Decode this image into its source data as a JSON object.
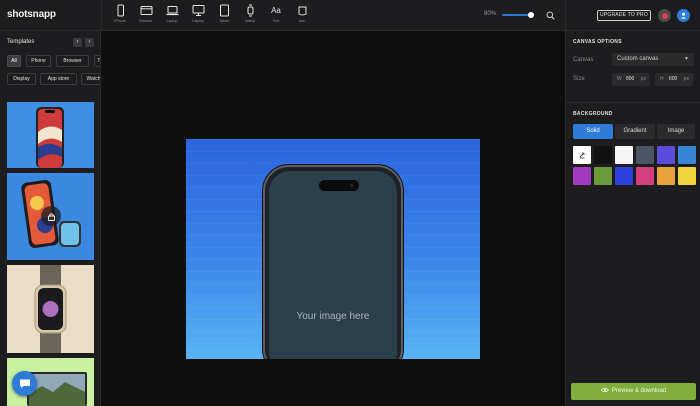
{
  "app": {
    "logo": "shotsnapp"
  },
  "devices": [
    {
      "icon": "phone-icon",
      "label": "iPhone"
    },
    {
      "icon": "browser-icon",
      "label": "Browser"
    },
    {
      "icon": "laptop-icon",
      "label": "Laptop"
    },
    {
      "icon": "display-icon",
      "label": "Display"
    },
    {
      "icon": "tablet-icon",
      "label": "Tablet"
    },
    {
      "icon": "watch-icon",
      "label": "Watch"
    },
    {
      "icon": "text-icon",
      "glyph": "Aa",
      "label": "Text"
    },
    {
      "icon": "icon-tool-icon",
      "label": "Icon"
    }
  ],
  "zoom": {
    "label": "80%",
    "value": 80
  },
  "header": {
    "upgrade_label": "UPGRADE TO PRO"
  },
  "sidebar": {
    "title": "Templates",
    "prev": "‹",
    "next": "›",
    "filters": [
      "All",
      "Phone",
      "Browser",
      "Ta",
      "Display",
      "App store",
      "Watch"
    ],
    "active_filter": "All"
  },
  "canvas": {
    "placeholder": "Your image here"
  },
  "canvas_options": {
    "title": "CANVAS OPTIONS",
    "canvas_label": "Canvas",
    "canvas_value": "Custom canvas",
    "size_label": "Size",
    "width_key": "W",
    "width_value": "800",
    "height_key": "H",
    "height_value": "600",
    "unit": "px"
  },
  "background": {
    "title": "BACKGROUND",
    "tabs": [
      "Solid",
      "Gradient",
      "Image"
    ],
    "active_tab": "Solid",
    "swatches": [
      "#ffffff",
      "#111111",
      "#f5f5f5",
      "#4b5563",
      "#5b4cdb",
      "#3a86d6",
      "#a33bc1",
      "#6b9a3a",
      "#2e3fe0",
      "#d43f7e",
      "#e9a13b",
      "#f1d33b"
    ]
  },
  "actions": {
    "preview_label": "Preview & download"
  }
}
